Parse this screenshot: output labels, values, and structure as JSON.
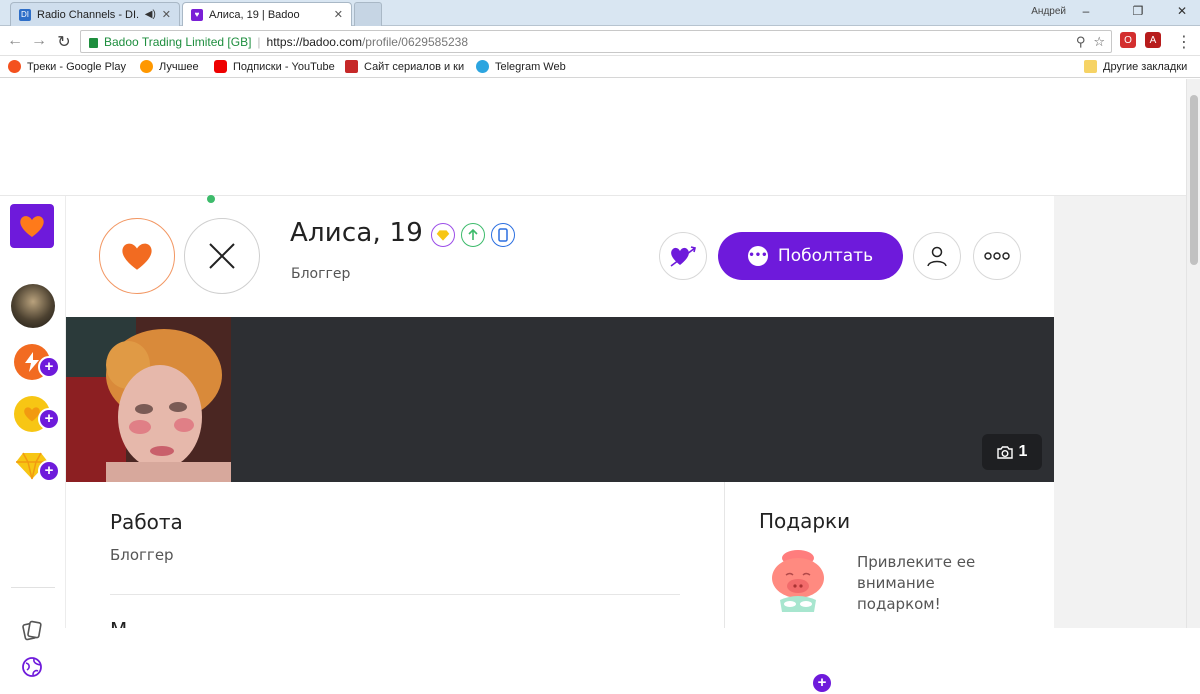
{
  "browser": {
    "tabs": [
      {
        "title": "Radio Channels - DI.F",
        "active": false
      },
      {
        "title": "Алиса, 19 | Badoo",
        "active": true
      }
    ],
    "user": "Андрей",
    "address": {
      "org": "Badoo Trading Limited [GB]",
      "host": "https://badoo.com",
      "path": "/profile/0629585238"
    },
    "bookmarks": [
      "Треки - Google Play",
      "Лучшее",
      "Подписки - YouTube",
      "Сайт сериалов и ки",
      "Telegram Web"
    ],
    "other_bookmarks": "Другие закладки"
  },
  "profile": {
    "name": "Алиса, 19",
    "subtitle": "Блоггер",
    "chat_label": "Поболтать",
    "photo_count": "1",
    "online": true
  },
  "sections": {
    "work_title": "Работа",
    "work_value": "Блоггер",
    "gifts_title": "Подарки",
    "gifts_text": "Привлеките ее внимание подарком!",
    "next_title_fragment": "М"
  },
  "colors": {
    "brand_purple": "#6e1adb",
    "like_orange": "#f26b21",
    "online_green": "#3dbb6b",
    "photo_strip_bg": "#2d2f33"
  },
  "icons": {
    "sidebar": [
      "heart-logo-icon",
      "lightning-icon",
      "heart-coin-icon",
      "diamond-icon",
      "cards-icon",
      "globe-icon"
    ],
    "badges": [
      "diamond-badge-icon",
      "arrow-up-badge-icon",
      "phone-badge-icon"
    ],
    "header_actions": [
      "crush-heart-icon",
      "chat-bubble-icon",
      "person-icon",
      "more-dots-icon"
    ]
  }
}
